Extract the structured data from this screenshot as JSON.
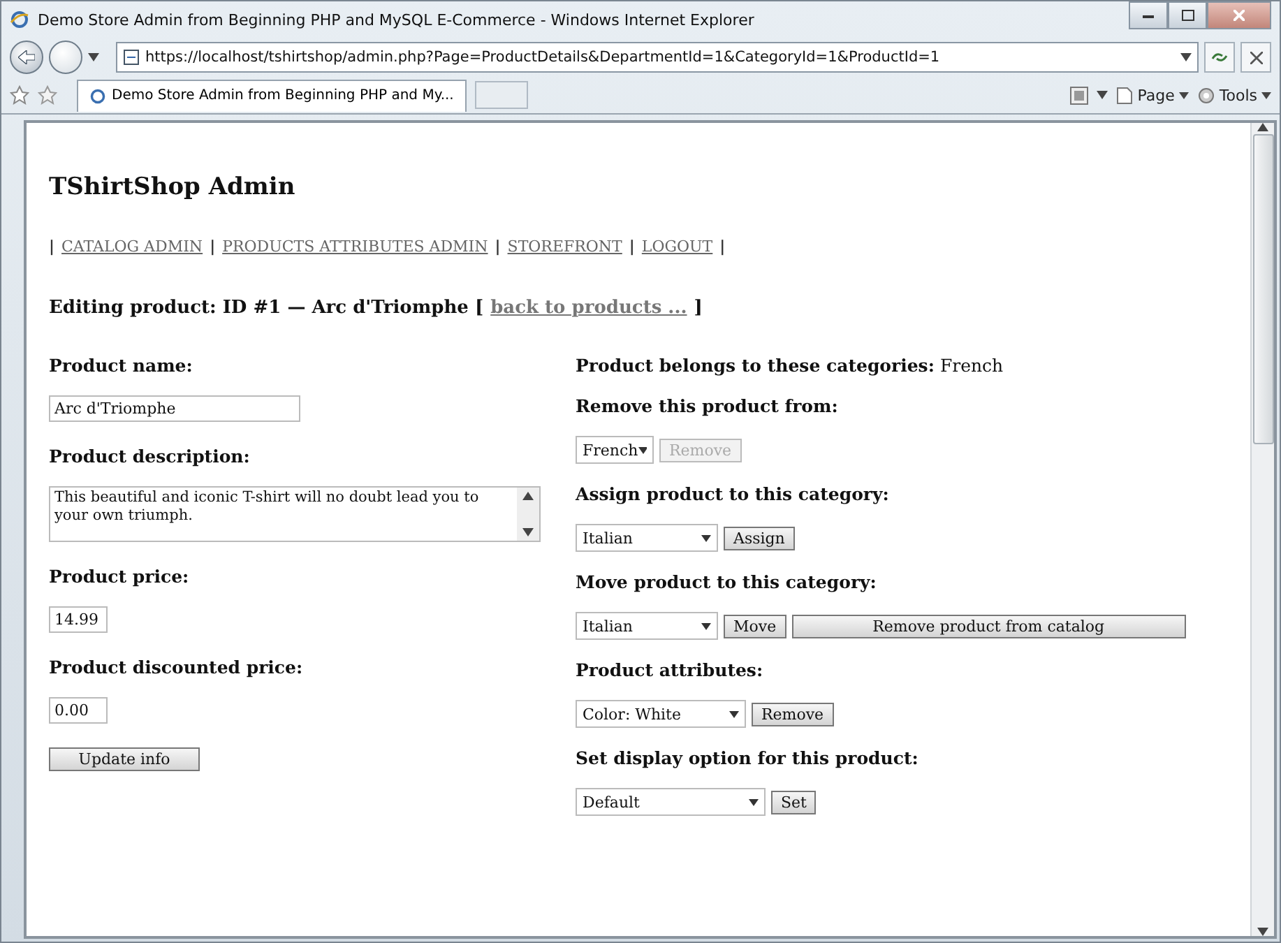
{
  "window": {
    "title": "Demo Store Admin from Beginning PHP and MySQL E-Commerce - Windows Internet Explorer"
  },
  "address_bar": {
    "url": "https://localhost/tshirtshop/admin.php?Page=ProductDetails&DepartmentId=1&CategoryId=1&ProductId=1"
  },
  "tabs": [
    {
      "label": "Demo Store Admin from Beginning PHP and My...",
      "selected": true
    }
  ],
  "command_bar": [
    "Page",
    "Tools"
  ],
  "page": {
    "title": "TShirtShop Admin",
    "nav": [
      {
        "kind": "separator",
        "text": "|"
      },
      {
        "kind": "link",
        "text": "CATALOG ADMIN"
      },
      {
        "kind": "separator",
        "text": "|"
      },
      {
        "kind": "link",
        "text": "PRODUCTS ATTRIBUTES ADMIN"
      },
      {
        "kind": "separator",
        "text": "|"
      },
      {
        "kind": "link",
        "text": "STOREFRONT"
      },
      {
        "kind": "separator",
        "text": "|"
      },
      {
        "kind": "link",
        "text": "LOGOUT"
      },
      {
        "kind": "separator",
        "text": "|"
      }
    ],
    "editing_heading": {
      "text": "Editing product: ID #1 — Arc d'Triomphe [",
      "link": "back to products ...",
      "close": "]"
    },
    "fields": [
      {
        "kind": "input",
        "label": "Product name:",
        "value": "Arc d'Triomphe"
      },
      {
        "kind": "textarea",
        "label": "Product description:",
        "value": "This beautiful and iconic T-shirt will no doubt lead you to your own triumph."
      },
      {
        "kind": "input",
        "label": "Product price:",
        "value": "14.99"
      },
      {
        "kind": "input",
        "label": "Product discounted price:",
        "value": "0.00"
      }
    ],
    "update_button": "Update info",
    "categories_line": "**Product belongs to these categories:** French",
    "sections": [
      {
        "heading": "Remove this product from:",
        "controls": [
          {
            "kind": "select",
            "value": "French"
          },
          {
            "kind": "button",
            "label": "Remove",
            "disabled": true
          }
        ]
      },
      {
        "heading": "Assign product to this category:",
        "controls": [
          {
            "kind": "select",
            "value": "Italian"
          },
          {
            "kind": "button",
            "label": "Assign",
            "disabled": false
          }
        ]
      },
      {
        "heading": "Move product to this category:",
        "controls": [
          {
            "kind": "select",
            "value": "Italian"
          },
          {
            "kind": "button",
            "label": "Move",
            "disabled": false
          },
          {
            "kind": "wide-button",
            "label": "Remove product from catalog",
            "disabled": false
          }
        ]
      },
      {
        "heading": "Product attributes:",
        "controls": [
          {
            "kind": "select",
            "value": "Color: White"
          },
          {
            "kind": "button",
            "label": "Remove",
            "disabled": false
          }
        ]
      },
      {
        "heading": "Set display option for this product:",
        "controls": [
          {
            "kind": "select",
            "value": "Default"
          },
          {
            "kind": "button",
            "label": "Set",
            "disabled": false
          }
        ]
      }
    ]
  }
}
